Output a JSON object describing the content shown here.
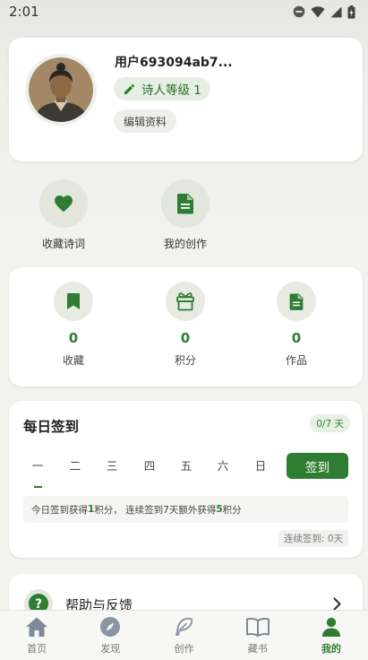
{
  "status_bar": {
    "time": "2:01"
  },
  "profile": {
    "username": "用户693094ab7...",
    "level": "诗人等级 1",
    "edit_label": "编辑资料"
  },
  "quick_actions": [
    {
      "label": "收藏诗词",
      "icon": "heart-icon"
    },
    {
      "label": "我的创作",
      "icon": "document-icon"
    }
  ],
  "stats": [
    {
      "value": "0",
      "label": "收藏",
      "icon": "bookmark-icon"
    },
    {
      "value": "0",
      "label": "积分",
      "icon": "gift-icon"
    },
    {
      "value": "0",
      "label": "作品",
      "icon": "document-icon"
    }
  ],
  "checkin": {
    "title": "每日签到",
    "progress": "0/7 天",
    "days": [
      "一",
      "二",
      "三",
      "四",
      "五",
      "六",
      "日"
    ],
    "button_label": "签到",
    "info": {
      "p1": "今日签到获得",
      "n1": "1",
      "p2": "积分， 连续签到7天额外获得",
      "n2": "5",
      "p3": "积分"
    },
    "streak": "连续签到: 0天"
  },
  "help": {
    "label": "帮助与反馈"
  },
  "tabbar": [
    {
      "label": "首页",
      "icon": "home-icon"
    },
    {
      "label": "发现",
      "icon": "compass-icon"
    },
    {
      "label": "创作",
      "icon": "feather-icon"
    },
    {
      "label": "藏书",
      "icon": "book-icon"
    },
    {
      "label": "我的",
      "icon": "person-icon"
    }
  ],
  "colors": {
    "accent": "#2e7d32",
    "accent_soft": "#e7efe4",
    "background": "#f2f2ee"
  }
}
